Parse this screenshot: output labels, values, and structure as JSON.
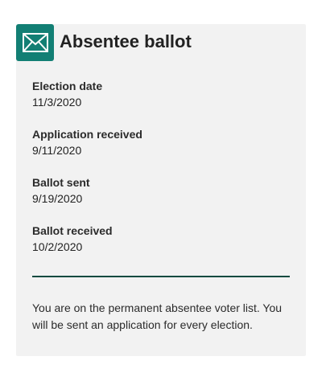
{
  "card": {
    "icon": "envelope-icon",
    "accent_color": "#127f74",
    "divider_color": "#0e4a40",
    "title": "Absentee ballot"
  },
  "fields": [
    {
      "label": "Election date",
      "value": "11/3/2020"
    },
    {
      "label": "Application received",
      "value": "9/11/2020"
    },
    {
      "label": "Ballot sent",
      "value": "9/19/2020"
    },
    {
      "label": "Ballot received",
      "value": "10/2/2020"
    }
  ],
  "note": "You are on the permanent absentee voter list. You will be sent an application for every election."
}
